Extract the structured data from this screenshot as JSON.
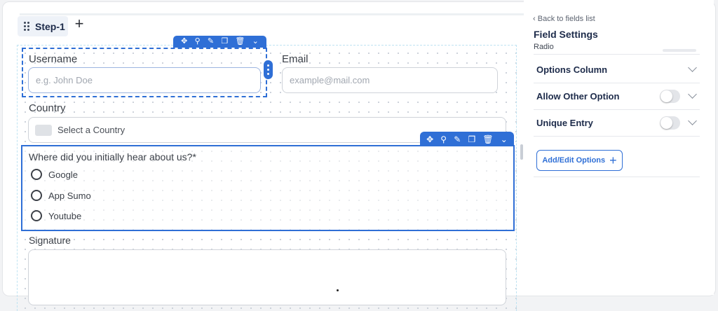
{
  "step": {
    "tab_label": "Step-1",
    "add_icon": "+"
  },
  "form": {
    "username": {
      "label": "Username",
      "placeholder": "e.g. John Doe"
    },
    "email": {
      "label": "Email",
      "placeholder": "example@mail.com"
    },
    "country": {
      "label": "Country",
      "placeholder": "Select a Country"
    },
    "radio_question": "Where did you initially hear about us?*",
    "radio_options": [
      "Google",
      "App Sumo",
      "Youtube"
    ],
    "signature_label": "Signature"
  },
  "panel": {
    "back_label": "Back to fields list",
    "title": "Field Settings",
    "field_type": "Radio",
    "rows": [
      {
        "label": "Options Column",
        "has_toggle": false
      },
      {
        "label": "Allow Other Option",
        "has_toggle": true,
        "toggle_on": false
      },
      {
        "label": "Unique Entry",
        "has_toggle": true,
        "toggle_on": false
      }
    ],
    "add_edit_label": "Add/Edit Options"
  },
  "colors": {
    "accent": "#2f6fd6",
    "text_dark": "#1d2b4a"
  }
}
